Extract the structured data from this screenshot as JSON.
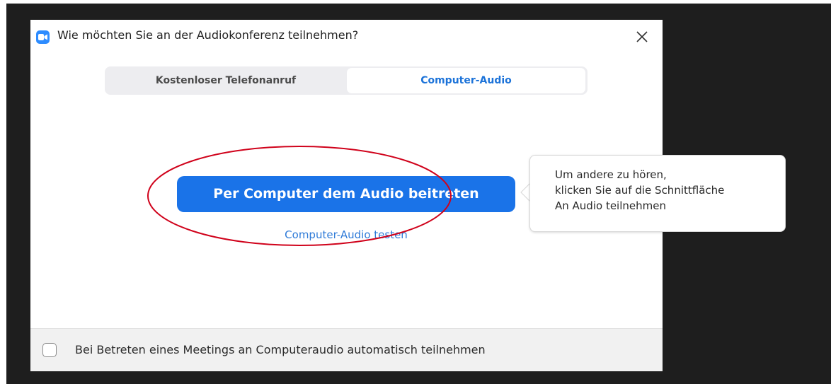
{
  "dialog": {
    "title": "Wie möchten Sie an der Audiokonferenz teilnehmen?",
    "app_icon": "zoom-video-icon",
    "close_icon": "close-icon"
  },
  "tabs": [
    {
      "label": "Kostenloser Telefonanruf",
      "selected": false
    },
    {
      "label": "Computer-Audio",
      "selected": true
    }
  ],
  "main": {
    "join_button_label": "Per Computer dem Audio beitreten",
    "test_link_label": "Computer-Audio testen",
    "annotation": "red-ellipse-highlight"
  },
  "tooltip": {
    "lines": [
      "Um andere zu hören,",
      "klicken Sie auf die Schnittfläche",
      "An Audio teilnehmen"
    ]
  },
  "footer": {
    "checkbox_checked": false,
    "checkbox_label": "Bei Betreten eines Meetings an Computeraudio automatisch teilnehmen"
  },
  "colors": {
    "accent": "#1a73e8",
    "link": "#2f7bd8",
    "background_dark": "#1e1e1e",
    "annotation_red": "#d0021b"
  }
}
